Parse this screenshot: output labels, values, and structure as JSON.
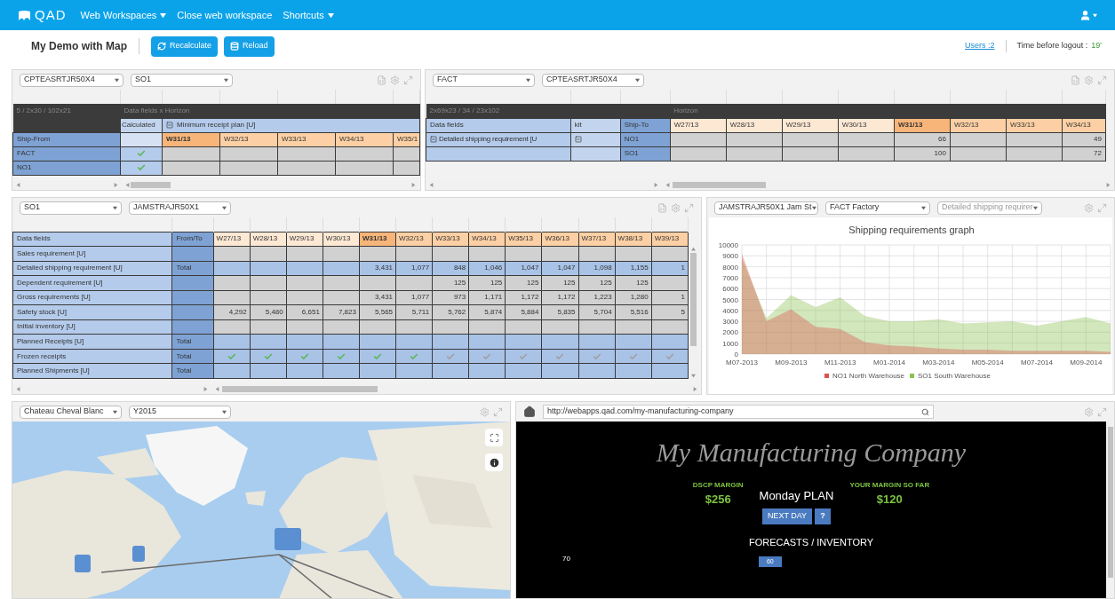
{
  "app_bar": {
    "logo": "QAD",
    "menus": [
      {
        "label": "Web Workspaces",
        "has_menu": true
      },
      {
        "label": "Close web workspace",
        "has_menu": false
      },
      {
        "label": "Shortcuts",
        "has_menu": true
      }
    ]
  },
  "toolbar": {
    "title": "My Demo with Map",
    "buttons": [
      {
        "label": "Recalculate",
        "kind": "recalculate"
      },
      {
        "label": "Reload",
        "kind": "reload"
      }
    ],
    "users_link": "Users :2",
    "logout_label": "Time before logout :",
    "logout_value": "19'"
  },
  "receipt_panel": {
    "selectors": [
      "CPTEASRTJR50X4",
      "SO1"
    ],
    "info": "5 / 2x30 / 102x21",
    "axis_label": "Data fields x Horizon",
    "calc_label": "Calculated",
    "group_label": "Minimum receipt plan [U]",
    "row_header": "Ship-From",
    "weeks": [
      {
        "label": "W31/13",
        "kind": "current"
      },
      {
        "label": "W32/13",
        "kind": "future"
      },
      {
        "label": "W33/13",
        "kind": "future"
      },
      {
        "label": "W34/13",
        "kind": "future"
      },
      {
        "label": "W35/1",
        "kind": "future"
      }
    ],
    "rows": [
      {
        "label": "FACT",
        "calculated": true
      },
      {
        "label": "NO1",
        "calculated": true
      }
    ]
  },
  "shipping_panel": {
    "selectors": [
      "FACT",
      "CPTEASRTJR50X4"
    ],
    "info": "2x69x23 / 34 / 23x102",
    "axis_label": "Horizon",
    "columns": [
      "Data fields",
      "kit",
      "Ship-To"
    ],
    "weeks": [
      {
        "label": "W27/13",
        "kind": "past"
      },
      {
        "label": "W28/13",
        "kind": "past"
      },
      {
        "label": "W29/13",
        "kind": "past"
      },
      {
        "label": "W30/13",
        "kind": "past"
      },
      {
        "label": "W31/13",
        "kind": "current"
      },
      {
        "label": "W32/13",
        "kind": "future"
      },
      {
        "label": "W33/13",
        "kind": "future"
      },
      {
        "label": "W34/13",
        "kind": "future"
      }
    ],
    "rows": [
      {
        "field": "Detailed shipping requirement [U",
        "expandable": true,
        "ship_to": "NO1",
        "cells": [
          {},
          {},
          {},
          {},
          {
            "value": "66"
          },
          {},
          {},
          {
            "value": "49"
          }
        ]
      },
      {
        "expandable": false,
        "ship_to": "SO1",
        "cells": [
          {},
          {},
          {},
          {},
          {
            "value": "100"
          },
          {},
          {},
          {
            "value": "72"
          }
        ]
      }
    ]
  },
  "planning_panel": {
    "selectors": [
      "SO1",
      "JAMSTRAJR50X1"
    ],
    "columns": [
      "Data fields",
      "From/To"
    ],
    "weeks": [
      {
        "label": "W27/13",
        "kind": "past"
      },
      {
        "label": "W28/13",
        "kind": "past"
      },
      {
        "label": "W29/13",
        "kind": "past"
      },
      {
        "label": "W30/13",
        "kind": "past"
      },
      {
        "label": "W31/13",
        "kind": "current"
      },
      {
        "label": "W32/13",
        "kind": "future"
      },
      {
        "label": "W33/13",
        "kind": "future"
      },
      {
        "label": "W34/13",
        "kind": "future"
      },
      {
        "label": "W35/13",
        "kind": "future"
      },
      {
        "label": "W36/13",
        "kind": "future"
      },
      {
        "label": "W37/13",
        "kind": "future"
      },
      {
        "label": "W38/13",
        "kind": "future"
      },
      {
        "label": "W39/13",
        "kind": "future"
      }
    ],
    "rows": [
      {
        "label": "Sales requirement [U]",
        "kind": "detail",
        "cells": [
          {},
          {},
          {},
          {},
          {},
          {},
          {},
          {},
          {},
          {},
          {},
          {},
          {}
        ]
      },
      {
        "label": "Detailed shipping requirement [U]",
        "from_to": "Total",
        "kind": "summary",
        "cells": [
          {},
          {},
          {},
          {},
          {
            "value": "3,431"
          },
          {
            "value": "1,077"
          },
          {
            "value": "848"
          },
          {
            "value": "1,046"
          },
          {
            "value": "1,047"
          },
          {
            "value": "1,047"
          },
          {
            "value": "1,098"
          },
          {
            "value": "1,155"
          },
          {
            "value": "1"
          }
        ]
      },
      {
        "label": "Dependent requirement [U]",
        "kind": "detail",
        "cells": [
          {},
          {},
          {},
          {},
          {},
          {},
          {
            "value": "125"
          },
          {
            "value": "125"
          },
          {
            "value": "125"
          },
          {
            "value": "125"
          },
          {
            "value": "125"
          },
          {
            "value": "125"
          },
          {}
        ]
      },
      {
        "label": "Gross requirements [U]",
        "kind": "detail",
        "cells": [
          {},
          {},
          {},
          {},
          {
            "value": "3,431"
          },
          {
            "value": "1,077"
          },
          {
            "value": "973"
          },
          {
            "value": "1,171"
          },
          {
            "value": "1,172"
          },
          {
            "value": "1,172"
          },
          {
            "value": "1,223"
          },
          {
            "value": "1,280"
          },
          {
            "value": "1"
          }
        ]
      },
      {
        "label": "Safety stock [U]",
        "kind": "detail",
        "cells": [
          {
            "value": "4,292"
          },
          {
            "value": "5,480"
          },
          {
            "value": "6,651"
          },
          {
            "value": "7,823"
          },
          {
            "value": "5,565"
          },
          {
            "value": "5,711"
          },
          {
            "value": "5,762"
          },
          {
            "value": "5,874"
          },
          {
            "value": "5,884"
          },
          {
            "value": "5,835"
          },
          {
            "value": "5,704"
          },
          {
            "value": "5,516"
          },
          {
            "value": "5"
          }
        ]
      },
      {
        "label": "Initial inventory [U]",
        "kind": "detail",
        "cells": [
          {},
          {},
          {},
          {},
          {},
          {},
          {},
          {},
          {},
          {},
          {},
          {},
          {}
        ]
      },
      {
        "label": "Planned Receipts [U]",
        "from_to": "Total",
        "kind": "summary",
        "cells": [
          {},
          {},
          {},
          {},
          {},
          {},
          {},
          {},
          {},
          {},
          {},
          {},
          {}
        ]
      },
      {
        "label": "Frozen receipts",
        "from_to": "Total",
        "kind": "check",
        "cells": [
          {
            "checked": true
          },
          {
            "checked": true
          },
          {
            "checked": true
          },
          {
            "checked": true
          },
          {
            "checked": true
          },
          {
            "checked": true
          },
          {
            "checked": false
          },
          {
            "checked": false
          },
          {
            "checked": false
          },
          {
            "checked": false
          },
          {
            "checked": false
          },
          {
            "checked": false
          },
          {
            "checked": false
          }
        ]
      },
      {
        "label": "Planned Shipments [U]",
        "from_to": "Total",
        "kind": "summary",
        "cells": [
          {},
          {},
          {},
          {},
          {},
          {},
          {},
          {},
          {},
          {},
          {},
          {},
          {}
        ]
      }
    ]
  },
  "chart_panel": {
    "selectors": [
      {
        "label": "JAMSTRAJR50X1 Jam St",
        "disabled": false
      },
      {
        "label": "FACT Factory",
        "disabled": false
      },
      {
        "label": "Detailed shipping requirer",
        "disabled": true
      }
    ],
    "chart_data": {
      "type": "area",
      "title": "Shipping requirements graph",
      "categories": [
        "M07-2013",
        null,
        "M09-2013",
        null,
        "M11-2013",
        null,
        "M01-2014",
        null,
        "M03-2014",
        null,
        "M05-2014",
        null,
        "M07-2014",
        null,
        "M09-2014",
        null
      ],
      "ylim": [
        0,
        10000
      ],
      "yticks": [
        0,
        1000,
        2000,
        3000,
        4000,
        5000,
        6000,
        7000,
        8000,
        9000,
        10000
      ],
      "stacked": false,
      "grid": true,
      "legend": "bottom",
      "series": [
        {
          "name": "NO1 North Warehouse",
          "color": "#d9534f",
          "values": [
            9200,
            3000,
            4100,
            2500,
            2300,
            1100,
            800,
            700,
            500,
            400,
            400,
            300,
            300,
            300,
            300,
            200
          ]
        },
        {
          "name": "SO1 South Warehouse",
          "color": "#8cc152",
          "values": [
            8800,
            3300,
            5400,
            4300,
            5200,
            3500,
            3000,
            3000,
            3200,
            2800,
            2900,
            3000,
            2600,
            3000,
            3400,
            2800
          ]
        }
      ]
    }
  },
  "map_panel": {
    "selectors": [
      "Chateau Cheval Blanc",
      "Y2015"
    ],
    "map": {
      "kind": "picture"
    }
  },
  "web_panel": {
    "url": "http://webapps.qad.com/my-manufacturing-company",
    "site_title": "My Manufacturing Company",
    "metrics": [
      {
        "label": "DSCP MARGIN",
        "value": "$256"
      },
      {
        "label": "YOUR MARGIN SO FAR",
        "value": "$120"
      }
    ],
    "plan": "Monday PLAN",
    "next_button": "NEXT DAY",
    "help_button": "?",
    "section": "FORECASTS / INVENTORY",
    "axis_tick": "70",
    "bar_label": "60"
  }
}
